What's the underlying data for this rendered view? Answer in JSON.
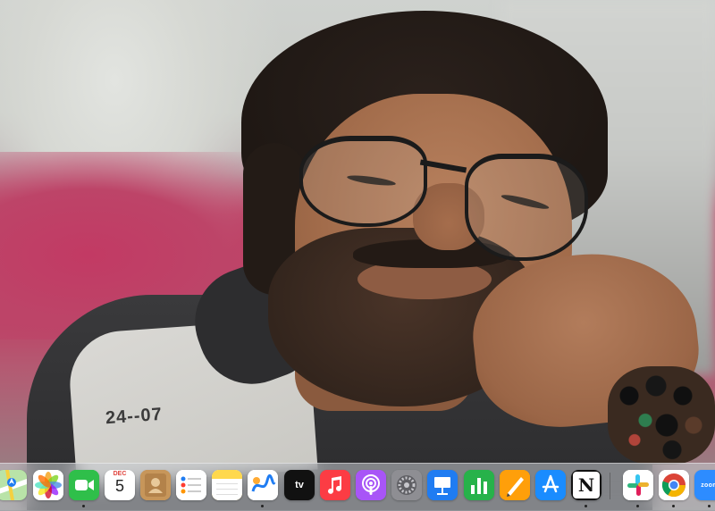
{
  "scene": {
    "shirt_print": "24--07"
  },
  "dock": {
    "items": [
      {
        "id": "maps",
        "name": "Maps",
        "icon": "maps-icon",
        "color": "#4caf50",
        "running": false
      },
      {
        "id": "photos",
        "name": "Photos",
        "icon": "photos-icon",
        "color": "#ffffff",
        "running": false
      },
      {
        "id": "facetime",
        "name": "FaceTime",
        "icon": "facetime-icon",
        "color": "#2fbf4a",
        "running": true
      },
      {
        "id": "calendar",
        "name": "Calendar",
        "icon": "calendar-icon",
        "color": "#ffffff",
        "month": "DEC",
        "day": "5",
        "running": false
      },
      {
        "id": "contacts",
        "name": "Contacts",
        "icon": "contacts-icon",
        "color": "#c7965a",
        "running": false
      },
      {
        "id": "reminders",
        "name": "Reminders",
        "icon": "reminders-icon",
        "color": "#ffffff",
        "running": false
      },
      {
        "id": "notes",
        "name": "Notes",
        "icon": "notes-icon",
        "color": "#ffd84d",
        "running": false
      },
      {
        "id": "freeform",
        "name": "Freeform",
        "icon": "freeform-icon",
        "color": "#ffffff",
        "running": true
      },
      {
        "id": "tv",
        "name": "TV",
        "icon": "apple-tv-icon",
        "color": "#111111",
        "label": "tv",
        "running": false
      },
      {
        "id": "music",
        "name": "Music",
        "icon": "music-icon",
        "color": "#fc3c44",
        "running": false
      },
      {
        "id": "podcasts",
        "name": "Podcasts",
        "icon": "podcasts-icon",
        "color": "#a855f7",
        "running": false
      },
      {
        "id": "settings",
        "name": "System Settings",
        "icon": "settings-gear-icon",
        "color": "#8e8e93",
        "running": false
      },
      {
        "id": "keynote",
        "name": "Keynote",
        "icon": "keynote-icon",
        "color": "#1f7cf2",
        "running": false
      },
      {
        "id": "numbers",
        "name": "Numbers",
        "icon": "numbers-icon",
        "color": "#27b24a",
        "running": false
      },
      {
        "id": "pages",
        "name": "Pages",
        "icon": "pages-icon",
        "color": "#ff9f0a",
        "running": false
      },
      {
        "id": "appstore",
        "name": "App Store",
        "icon": "app-store-icon",
        "color": "#1a8cff",
        "running": false
      },
      {
        "id": "notion",
        "name": "Notion",
        "icon": "notion-icon",
        "color": "#ffffff",
        "label": "N",
        "running": true
      },
      {
        "id": "slack",
        "name": "Slack",
        "icon": "slack-icon",
        "color": "#ffffff",
        "running": true
      },
      {
        "id": "chrome",
        "name": "Google Chrome",
        "icon": "chrome-icon",
        "color": "#ffffff",
        "running": true
      },
      {
        "id": "zoom",
        "name": "Zoom",
        "icon": "zoom-icon",
        "color": "#2d8cff",
        "label": "zoom",
        "running": true
      }
    ]
  }
}
